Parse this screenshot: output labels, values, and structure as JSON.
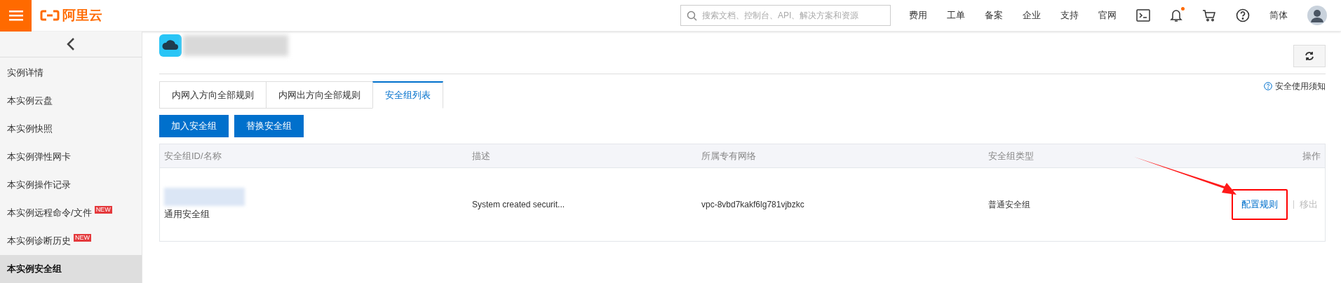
{
  "header": {
    "logo": "阿里云",
    "search": {
      "placeholder": "搜索文档、控制台、API、解决方案和资源"
    },
    "nav": [
      "费用",
      "工单",
      "备案",
      "企业",
      "支持",
      "官网"
    ],
    "icons": [
      {
        "kind": "terminal",
        "badge": false
      },
      {
        "kind": "bell",
        "badge": true
      },
      {
        "kind": "cart",
        "badge": false
      },
      {
        "kind": "help",
        "badge": false
      }
    ],
    "language": "简体"
  },
  "sidebar": {
    "items": [
      {
        "label": "实例详情",
        "selected": false
      },
      {
        "label": "本实例云盘",
        "selected": false
      },
      {
        "label": "本实例快照",
        "selected": false
      },
      {
        "label": "本实例弹性网卡",
        "selected": false
      },
      {
        "label": "本实例操作记录",
        "selected": false
      },
      {
        "label": "本实例远程命令/文件",
        "badge": "NEW",
        "selected": false
      },
      {
        "label": "本实例诊断历史",
        "badge": "NEW",
        "selected": false
      },
      {
        "label": "本实例安全组",
        "selected": true
      }
    ]
  },
  "help_link": "安全使用须知",
  "tabs": [
    {
      "label": "内网入方向全部规则",
      "selected": false
    },
    {
      "label": "内网出方向全部规则",
      "selected": false
    },
    {
      "label": "安全组列表",
      "selected": true
    }
  ],
  "buttons": [
    "加入安全组",
    "替换安全组"
  ],
  "table": {
    "columns": [
      "安全组ID/名称",
      "描述",
      "所属专有网络",
      "安全组类型",
      "操作"
    ],
    "rows": [
      {
        "name": "通用安全组",
        "description": "System created securit...",
        "vpc": "vpc-8vbd7kakf6lg781vjbzkc",
        "type": "普通安全组",
        "actions": [
          {
            "label": "配置规则",
            "disabled": false,
            "highlighted": true
          },
          {
            "label": "移出",
            "disabled": true,
            "highlighted": false
          }
        ]
      }
    ]
  }
}
